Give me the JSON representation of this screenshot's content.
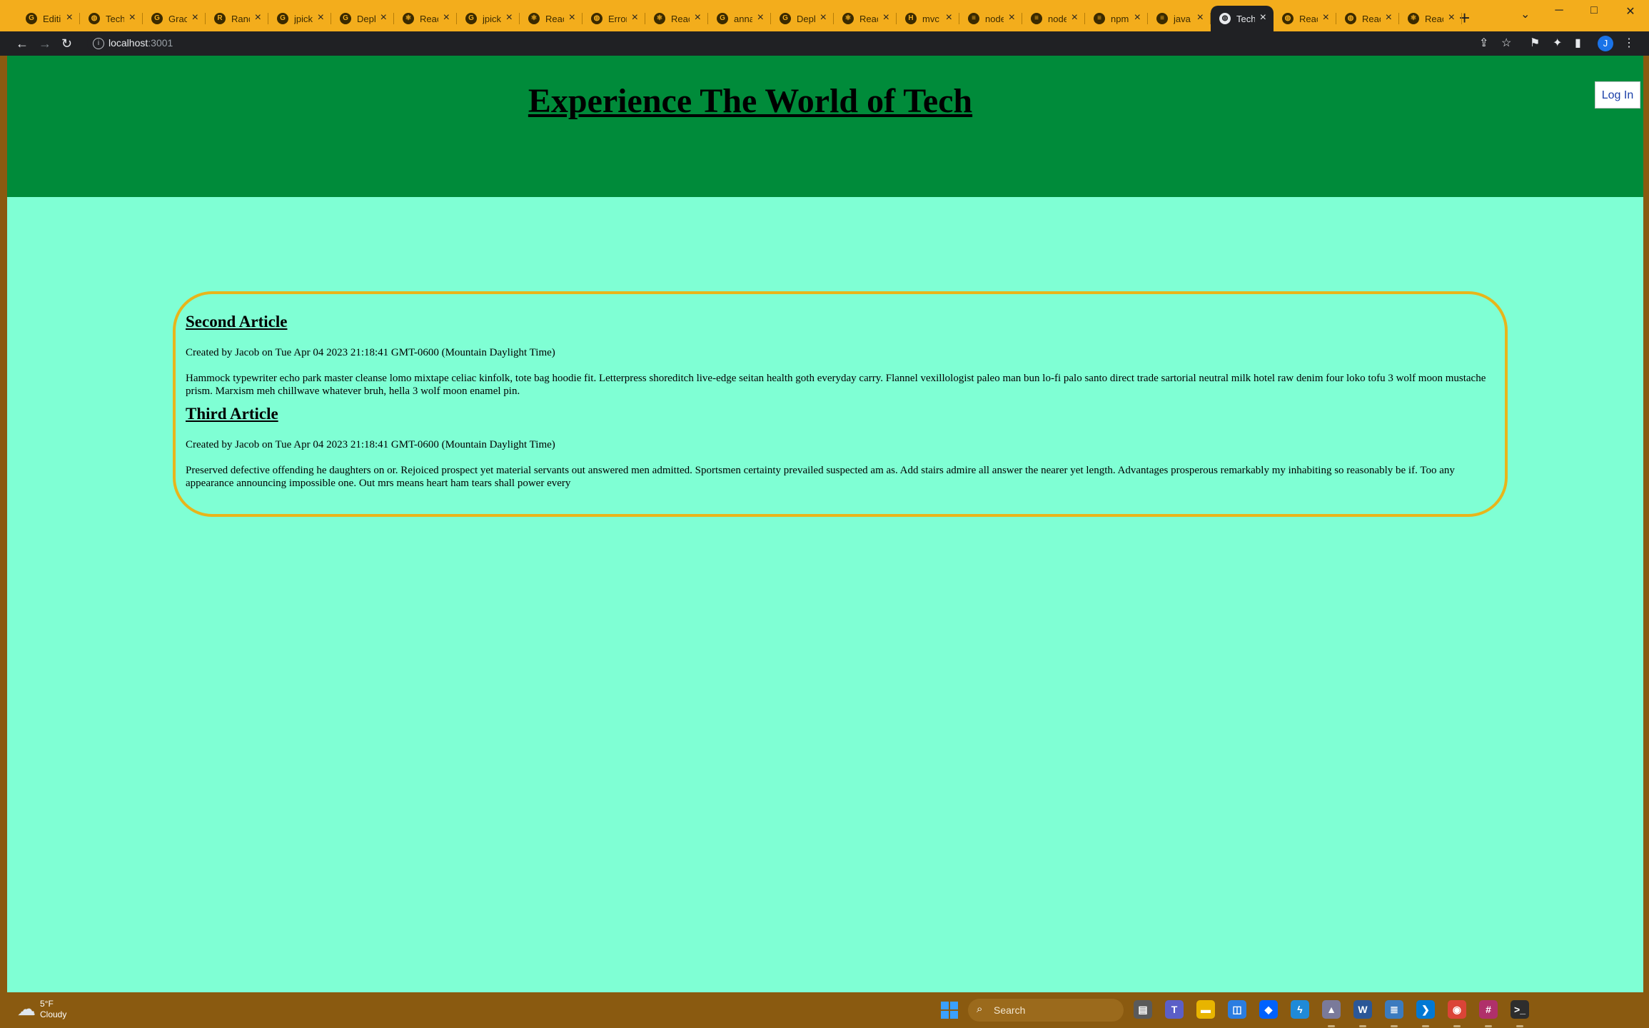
{
  "browser": {
    "tabs": [
      {
        "title": "Editi",
        "icon": "github-icon",
        "glyph": "G"
      },
      {
        "title": "Tech",
        "icon": "globe-icon",
        "glyph": "◍"
      },
      {
        "title": "Grac",
        "icon": "grader-icon",
        "glyph": "G"
      },
      {
        "title": "Rand",
        "icon": "random-icon",
        "glyph": "R"
      },
      {
        "title": "jpick",
        "icon": "github-icon",
        "glyph": "G"
      },
      {
        "title": "Depl",
        "icon": "github-icon",
        "glyph": "G"
      },
      {
        "title": "Reac",
        "icon": "react-icon",
        "glyph": "⚛"
      },
      {
        "title": "jpick",
        "icon": "github-icon",
        "glyph": "G"
      },
      {
        "title": "Reac",
        "icon": "react-icon",
        "glyph": "⚛"
      },
      {
        "title": "Error",
        "icon": "globe-icon",
        "glyph": "◍"
      },
      {
        "title": "Reac",
        "icon": "react-icon",
        "glyph": "⚛"
      },
      {
        "title": "anna",
        "icon": "github-icon",
        "glyph": "G"
      },
      {
        "title": "Depl",
        "icon": "github-icon",
        "glyph": "G"
      },
      {
        "title": "Reac",
        "icon": "react-icon",
        "glyph": "⚛"
      },
      {
        "title": "mvc",
        "icon": "heroku-icon",
        "glyph": "H"
      },
      {
        "title": "node",
        "icon": "stackoverflow-icon",
        "glyph": "≡"
      },
      {
        "title": "node",
        "icon": "stackoverflow-icon",
        "glyph": "≡"
      },
      {
        "title": "npm",
        "icon": "stackoverflow-icon",
        "glyph": "≡"
      },
      {
        "title": "java",
        "icon": "stackoverflow-icon",
        "glyph": "≡"
      },
      {
        "title": "Tech",
        "icon": "globe-icon",
        "glyph": "◍",
        "active": true
      },
      {
        "title": "Reac",
        "icon": "globe-icon",
        "glyph": "◍"
      },
      {
        "title": "Reac",
        "icon": "globe-icon",
        "glyph": "◍"
      },
      {
        "title": "Reac",
        "icon": "react-icon",
        "glyph": "⚛"
      }
    ],
    "url_host": "localhost",
    "url_port": ":3001",
    "profile_initial": "J"
  },
  "page": {
    "title": "Experience The World of Tech",
    "login_label": "Log In",
    "colors": {
      "header": "#008b3a",
      "background": "#7fffd4",
      "border": "#e8b51a"
    },
    "articles": [
      {
        "title": "Second Article",
        "meta": "Created by Jacob on Tue Apr 04 2023 21:18:41 GMT-0600 (Mountain Daylight Time)",
        "body": "Hammock typewriter echo park master cleanse lomo mixtape celiac kinfolk, tote bag hoodie fit. Letterpress shoreditch live-edge seitan health goth everyday carry. Flannel vexillologist paleo man bun lo-fi palo santo direct trade sartorial neutral milk hotel raw denim four loko tofu 3 wolf moon mustache prism. Marxism meh chillwave whatever bruh, hella 3 wolf moon enamel pin."
      },
      {
        "title": "Third Article",
        "meta": "Created by Jacob on Tue Apr 04 2023 21:18:41 GMT-0600 (Mountain Daylight Time)",
        "body": "Preserved defective offending he daughters on or. Rejoiced prospect yet material servants out answered men admitted. Sportsmen certainty prevailed suspected am as. Add stairs admire all answer the nearer yet length. Advantages prosperous remarkably my inhabiting so reasonably be if. Too any appearance announcing impossible one. Out mrs means heart ham tears shall power every"
      }
    ]
  },
  "taskbar": {
    "weather_temp": "5°F",
    "weather_desc": "Cloudy",
    "search_label": "Search",
    "apps": [
      {
        "name": "file-explorer-icon",
        "glyph": "▤",
        "color": "#5a5a5a"
      },
      {
        "name": "teams-icon",
        "glyph": "T",
        "color": "#5b5fc7"
      },
      {
        "name": "folder-icon",
        "glyph": "▬",
        "color": "#e8b400"
      },
      {
        "name": "store-icon",
        "glyph": "◫",
        "color": "#2a7de1"
      },
      {
        "name": "dropbox-icon",
        "glyph": "◆",
        "color": "#0061ff"
      },
      {
        "name": "vscode-bolt-icon",
        "glyph": "ϟ",
        "color": "#1f8ad8"
      },
      {
        "name": "git-icon",
        "glyph": "▲",
        "color": "#7a7a9a"
      },
      {
        "name": "word-icon",
        "glyph": "W",
        "color": "#2b5797"
      },
      {
        "name": "notepad-icon",
        "glyph": "≣",
        "color": "#3b7bbf"
      },
      {
        "name": "vscode-icon",
        "glyph": "❯",
        "color": "#0078d4"
      },
      {
        "name": "chrome-icon",
        "glyph": "◉",
        "color": "#db4437"
      },
      {
        "name": "slack-icon",
        "glyph": "#",
        "color": "#b0306a"
      },
      {
        "name": "terminal-icon",
        "glyph": ">_",
        "color": "#2d2d2d"
      }
    ]
  }
}
